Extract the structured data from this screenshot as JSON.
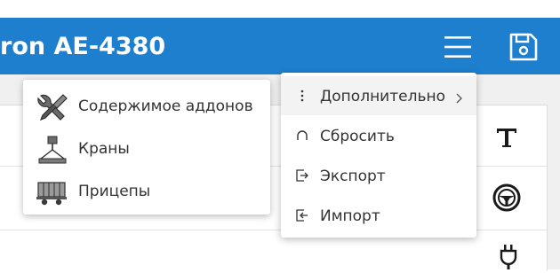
{
  "header": {
    "title": "ron AE-4380",
    "menu_icon": "hamburger-menu-icon",
    "save_icon": "save-floppy-icon"
  },
  "colors": {
    "header_bg": "#1e7fcf",
    "header_text": "#ffffff",
    "menu_text": "#333333",
    "menu_hover": "#f3f3f3"
  },
  "left_menu": {
    "items": [
      {
        "label": "Содержимое аддонов",
        "icon": "wrench-screwdriver-icon"
      },
      {
        "label": "Краны",
        "icon": "crane-hook-icon"
      },
      {
        "label": "Прицепы",
        "icon": "trailer-icon"
      }
    ]
  },
  "right_menu": {
    "items": [
      {
        "label": "Дополнительно",
        "icon": "vertical-dots-icon",
        "submenu": true
      },
      {
        "label": "Сбросить",
        "icon": "reset-arc-icon"
      },
      {
        "label": "Экспорт",
        "icon": "export-icon"
      },
      {
        "label": "Импорт",
        "icon": "import-icon"
      }
    ]
  },
  "side_icons": [
    "text-t-icon",
    "steering-wheel-icon",
    "plug-icon"
  ]
}
